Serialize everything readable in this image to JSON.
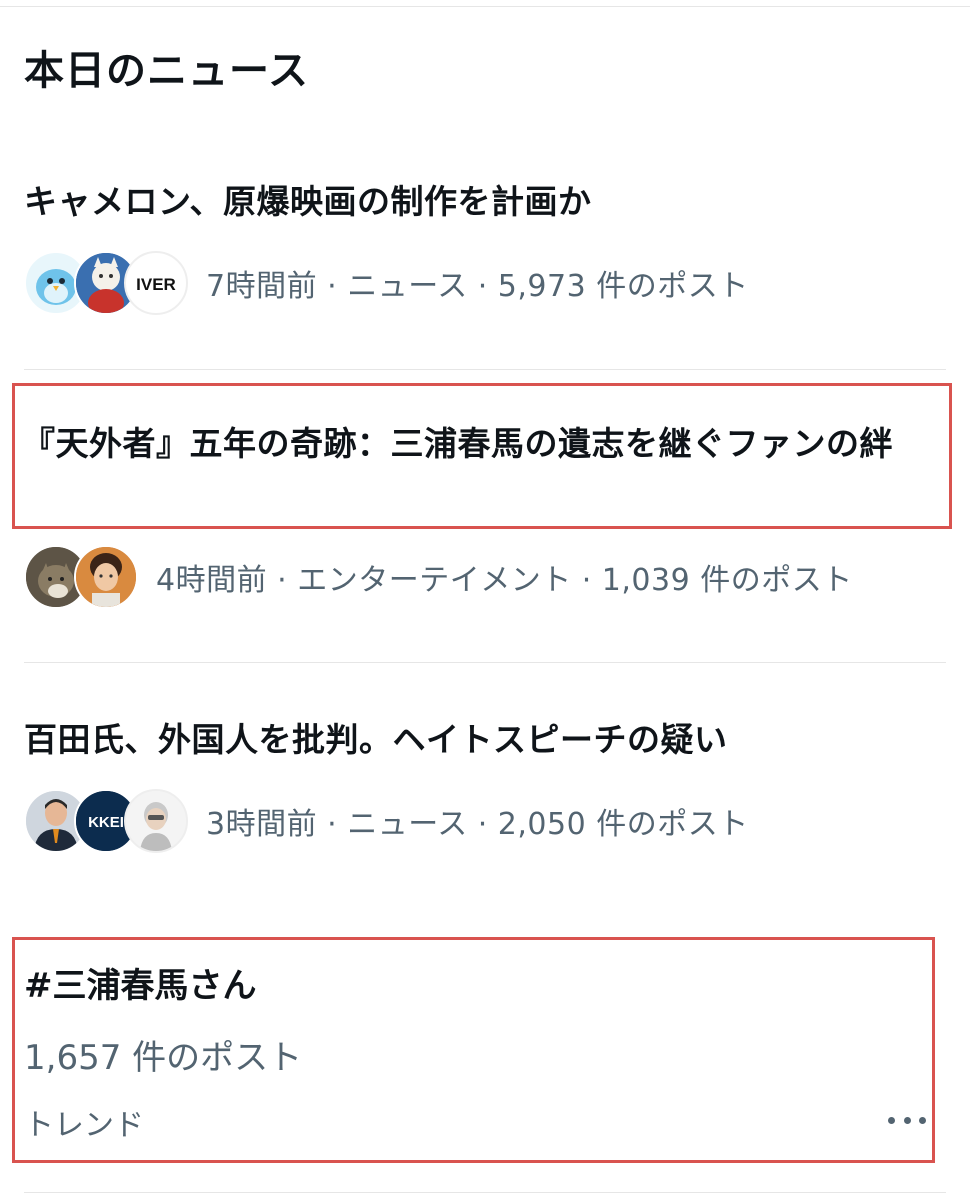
{
  "section": {
    "title": "本日のニュース"
  },
  "news": [
    {
      "headline": "キャメロン、原爆映画の制作を計画か",
      "meta": "7時間前 · ニュース · 5,973 件のポスト",
      "avatars": [
        "bird-avatar",
        "maneki-neko-avatar",
        "iver-logo-avatar"
      ],
      "avatar_text": [
        "",
        "",
        "IVER"
      ]
    },
    {
      "headline": "『天外者』五年の奇跡：三浦春馬の遺志を継ぐファンの絆",
      "meta": "4時間前 · エンターテイメント · 1,039 件のポスト",
      "avatars": [
        "cat-avatar",
        "person-avatar"
      ],
      "avatar_text": [
        "",
        ""
      ]
    },
    {
      "headline": "百田氏、外国人を批判。ヘイトスピーチの疑い",
      "meta": "3時間前 · ニュース · 2,050 件のポスト",
      "avatars": [
        "man-avatar",
        "nikkei-logo-avatar",
        "cartoon-avatar"
      ],
      "avatar_text": [
        "",
        "KKEI",
        ""
      ]
    }
  ],
  "trend": {
    "tag": "#三浦春馬さん",
    "count": "1,657 件のポスト",
    "label": "トレンド",
    "more_icon": "more-dots-icon"
  },
  "colors": {
    "text": "#0f1419",
    "secondary": "#536471",
    "highlight": "#d9534f",
    "divider": "#e6e6e6"
  }
}
